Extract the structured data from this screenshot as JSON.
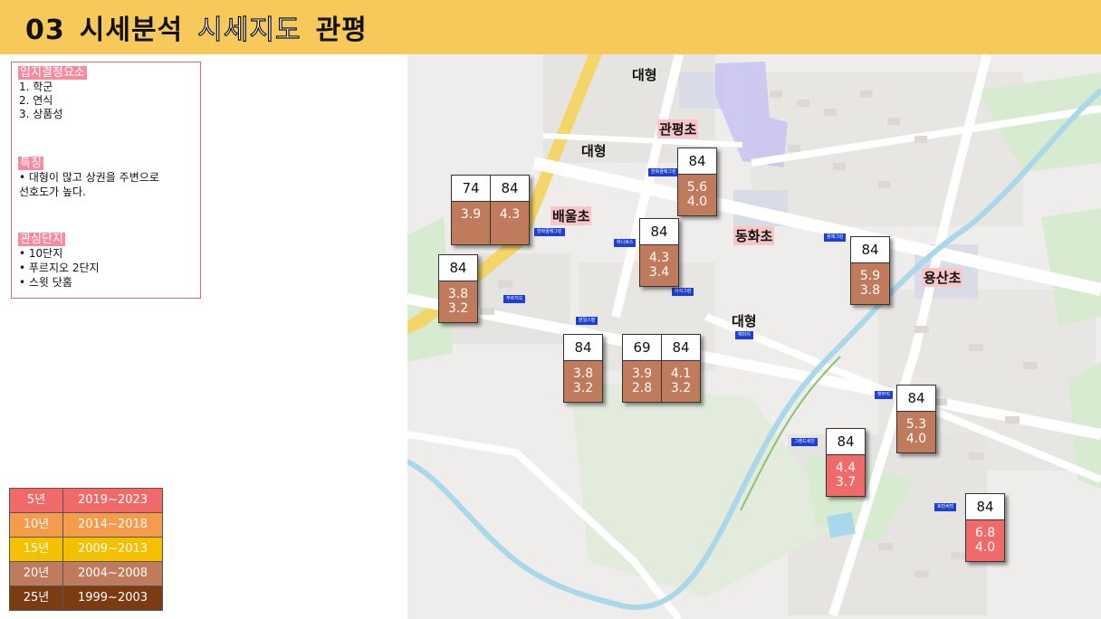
{
  "header": {
    "num": "03",
    "part1": "시세분석",
    "part2": "시세지도",
    "part3": "관평"
  },
  "info": {
    "section1_title": "입지결정요소",
    "section1_items": [
      "1.  학군",
      "2.  연식",
      "3.  상품성"
    ],
    "section2_title": "특징",
    "section2_items": [
      "•  대형이 많고 상권을 주변으로",
      "    선호도가 높다."
    ],
    "section3_title": "관심단지",
    "section3_items": [
      "•  10단지",
      "•  푸르지오 2단지",
      "•  스윗 닷홈"
    ]
  },
  "map_labels": {
    "large1": "대형",
    "large2": "대형",
    "large3": "대형",
    "school1": "관평초",
    "school2": "배울초",
    "school3": "동화초",
    "school4": "용산초"
  },
  "cards": [
    {
      "cols": [
        {
          "size": "74",
          "v1": "3.9",
          "v2": ""
        },
        {
          "size": "84",
          "v1": "4.3",
          "v2": ""
        }
      ],
      "red": false
    },
    {
      "cols": [
        {
          "size": "84",
          "v1": "5.6",
          "v2": "4.0"
        }
      ],
      "red": false
    },
    {
      "cols": [
        {
          "size": "84",
          "v1": "4.3",
          "v2": "3.4"
        }
      ],
      "red": false
    },
    {
      "cols": [
        {
          "size": "84",
          "v1": "3.8",
          "v2": "3.2"
        }
      ],
      "red": false
    },
    {
      "cols": [
        {
          "size": "84",
          "v1": "5.9",
          "v2": "3.8"
        }
      ],
      "red": false
    },
    {
      "cols": [
        {
          "size": "84",
          "v1": "3.8",
          "v2": "3.2"
        }
      ],
      "red": false
    },
    {
      "cols": [
        {
          "size": "69",
          "v1": "3.9",
          "v2": "2.8"
        },
        {
          "size": "84",
          "v1": "4.1",
          "v2": "3.2"
        }
      ],
      "red": false
    },
    {
      "cols": [
        {
          "size": "84",
          "v1": "5.3",
          "v2": "4.0"
        }
      ],
      "red": false
    },
    {
      "cols": [
        {
          "size": "84",
          "v1": "4.4",
          "v2": "3.7"
        }
      ],
      "red": true
    },
    {
      "cols": [
        {
          "size": "84",
          "v1": "6.8",
          "v2": "4.0"
        }
      ],
      "red": true
    }
  ],
  "pins": [
    "한화꿈에그린",
    "한화꿈에그린",
    "하나로스",
    "푸르지오",
    "꿈에그린",
    "원일스팔",
    "하하그린",
    "예미지",
    "햇무리",
    "그랜드세안",
    "호반써밋",
    "푸르지오"
  ],
  "legend": [
    {
      "age": "5년",
      "range": "2019~2023",
      "color": "#f06a6a"
    },
    {
      "age": "10년",
      "range": "2014~2018",
      "color": "#f59b4c"
    },
    {
      "age": "15년",
      "range": "2009~2013",
      "color": "#f5c000"
    },
    {
      "age": "20년",
      "range": "2004~2008",
      "color": "#c07a5c"
    },
    {
      "age": "25년",
      "range": "1999~2003",
      "color": "#7a3c10"
    }
  ]
}
